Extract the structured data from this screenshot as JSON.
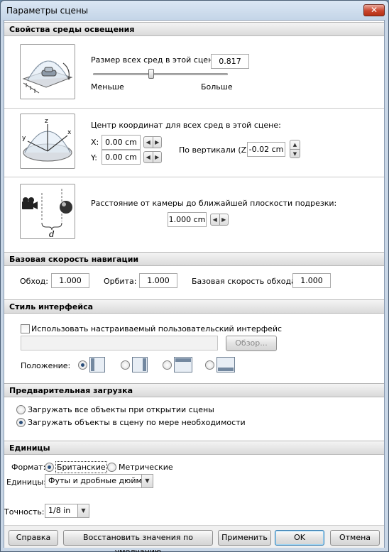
{
  "window": {
    "title": "Параметры сцены",
    "close_glyph": "✕"
  },
  "lighting": {
    "header": "Свойства среды освещения",
    "size": {
      "label": "Размер всех сред в этой сцене:",
      "value": "0.817",
      "min_label": "Меньше",
      "max_label": "Больше",
      "slider_fraction": 0.43
    },
    "center": {
      "label": "Центр координат для всех сред в этой сцене:",
      "x_label": "X:",
      "x_value": "0.00 cm",
      "y_label": "Y:",
      "y_value": "0.00 cm",
      "z_label": "По вертикали (Z):",
      "z_value": "-0.02 cm",
      "axis_z": "z",
      "axis_y": "y",
      "axis_x": "x"
    },
    "clip": {
      "label": "Расстояние от камеры до ближайшей плоскости подрезки:",
      "value": "1.000 cm",
      "d_label": "d"
    }
  },
  "navigation": {
    "header": "Базовая скорость навигации",
    "walk_label": "Обход:",
    "walk_value": "1.000",
    "orbit_label": "Орбита:",
    "orbit_value": "1.000",
    "base_label": "Базовая скорость обхода:",
    "base_value": "1.000"
  },
  "interface": {
    "header": "Стиль интерфейса",
    "custom_label": "Использовать настраиваемый пользовательский интерфейс",
    "custom_checked": false,
    "path_value": "",
    "browse_label": "Обзор...",
    "position_label": "Положение:",
    "position_selected": 0
  },
  "preload": {
    "header": "Предварительная загрузка",
    "option_all": "Загружать все объекты при открытии сцены",
    "option_needed": "Загружать объекты в сцену по мере необходимости",
    "selected": "needed"
  },
  "units": {
    "header": "Единицы",
    "format_label": "Формат:",
    "format_british": "Британские",
    "format_metric": "Метрические",
    "format_selected": "british",
    "units_label": "Единицы:",
    "units_value": "Футы и дробные дюймы",
    "precision_label": "Точность:",
    "precision_value": "1/8 in"
  },
  "buttons": {
    "help": "Справка",
    "restore": "Восстановить значения по умолчанию",
    "apply": "Применить",
    "ok": "OK",
    "cancel": "Отмена"
  },
  "icons": {
    "left": "◀",
    "right": "▶",
    "up": "▲",
    "down": "▼",
    "dropdown": "▼"
  }
}
